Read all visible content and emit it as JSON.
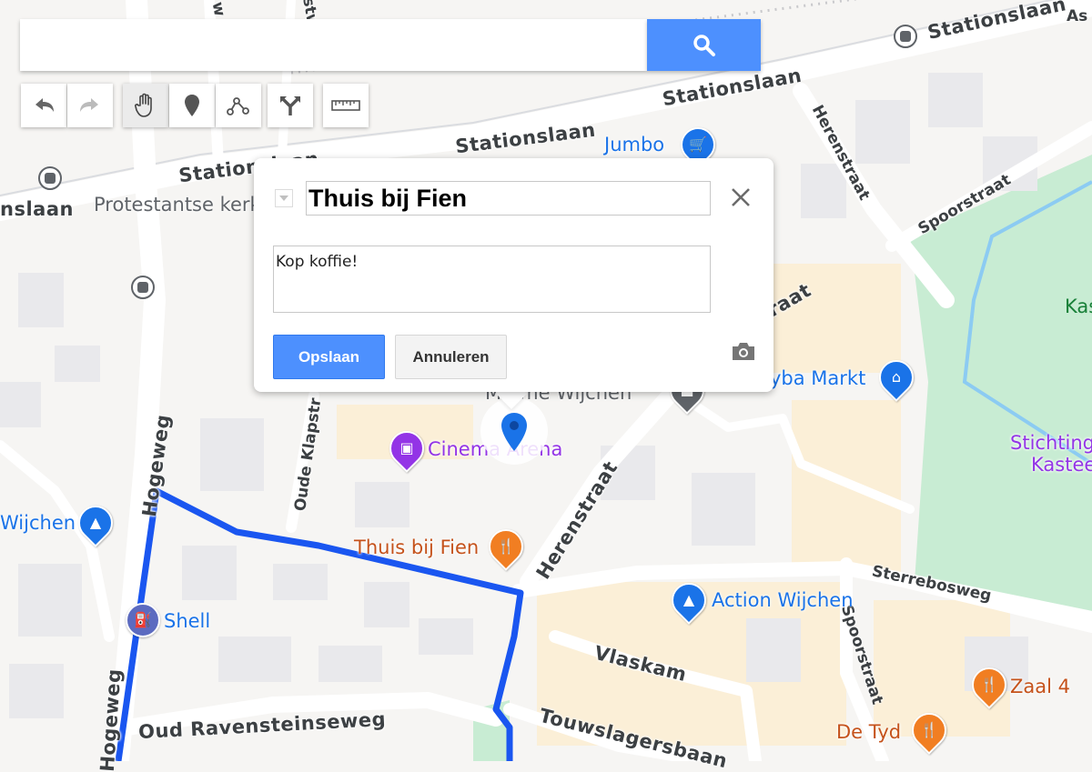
{
  "search": {
    "placeholder": "",
    "value": ""
  },
  "toolbar": {
    "undo_icon": "undo-arrow-icon",
    "redo_icon": "redo-arrow-icon",
    "pan_icon": "hand-icon",
    "marker_icon": "map-pin-icon",
    "line_icon": "draw-line-icon",
    "route_icon": "route-fork-icon",
    "measure_icon": "ruler-icon",
    "active": "pan"
  },
  "popup": {
    "title_value": "Thuis bij Fien",
    "description_value": "Kop koffie!",
    "save_label": "Opslaan",
    "cancel_label": "Annuleren"
  },
  "colors": {
    "accent": "#4d90fe",
    "route": "#1a56f0",
    "marker": "#1a73e8"
  },
  "map": {
    "roads": {
      "stationslaan_1": "Stationslaan",
      "stationslaan_2": "Stationslaan",
      "stationslaan_3": "Stationslaan",
      "stationslaan_4": "Stationslaan",
      "stationslaan_5": "nslaan",
      "herenstraat_1": "Herenstraat",
      "herenstraat_2": "Herenstraat",
      "spoorstraat_1": "Spoorstraat",
      "spoorstraat_2": "Spoorstraat",
      "hogeweg_1": "Hogeweg",
      "hogeweg_2": "Hogeweg",
      "oude_klapstraat": "Oude Klapstr",
      "oud_ravensteinseweg": "Oud Ravensteinseweg",
      "touwslagersbaan": "Touwslagersbaan",
      "vlaskam": "Vlaskam",
      "sterrebosweg": "Sterrebosweg",
      "raat": "raat",
      "west": "stw",
      "as": "As",
      "w": "w"
    },
    "pois": {
      "jumbo": "Jumbo",
      "protestantse": "Protestantse kerk",
      "markt": "yba Markt",
      "cinema": "Cinema Arena",
      "movie": "M          4me Wijchen",
      "thuis": "Thuis bij Fien",
      "wijchen": "Wijchen",
      "shell": "Shell",
      "action": "Action Wijchen",
      "stichting_1": "Stichting",
      "stichting_2": "Kastee",
      "kas": "Kas",
      "zaal": "Zaal 4",
      "detyd": "De Tyd"
    }
  }
}
